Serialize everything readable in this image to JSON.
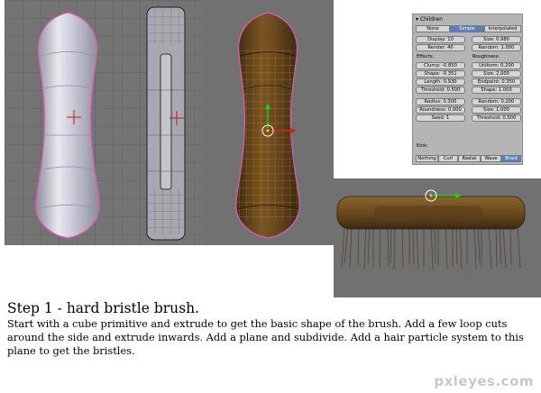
{
  "particle_panel": {
    "header": "Children",
    "child_modes": [
      "None",
      "Simple",
      "Interpolated"
    ],
    "active_child_mode": "Simple",
    "display": "Display: 10",
    "render": "Render: 40",
    "size": "Size: 0.980",
    "random": "Random: 1.000",
    "effects_label": "Effects:",
    "roughness_label": "Roughness:",
    "effects": [
      "Clump: -0.850",
      "Shape: -0.351",
      "Length: 0.930",
      "Threshold: 0.500"
    ],
    "roughness": [
      "Uniform: 0.200",
      "Size: 2.000",
      "Endpoint: 0.350",
      "Shape: 1.000"
    ],
    "radius": "Radius: 0.300",
    "roundness": "Roundness: 0.000",
    "seed": "Seed: 1",
    "random2": "Random: 0.200",
    "size2": "Size: 1.000",
    "threshold2": "Threshold: 0.500",
    "kink_label": "Kink:",
    "kink_modes": [
      "Nothing",
      "Curl",
      "Radial",
      "Wave",
      "Braid"
    ],
    "active_kink_mode": "Braid"
  },
  "caption": {
    "title": "Step 1 - hard bristle brush.",
    "body": "Start with a cube primitive and extrude to get the basic shape of the brush.  Add a few loop cuts around the side and extrude inwards.  Add a plane and subdivide.  Add a hair particle system to this plane to get the bristles."
  },
  "watermark": "pxleyes.com",
  "colors": {
    "viewport_grey": "#747474",
    "brush_wood": "#6b4a1f",
    "wire_orange": "#e5a43a",
    "selection_pink": "#e05ab8",
    "active_button": "#5680c2"
  }
}
